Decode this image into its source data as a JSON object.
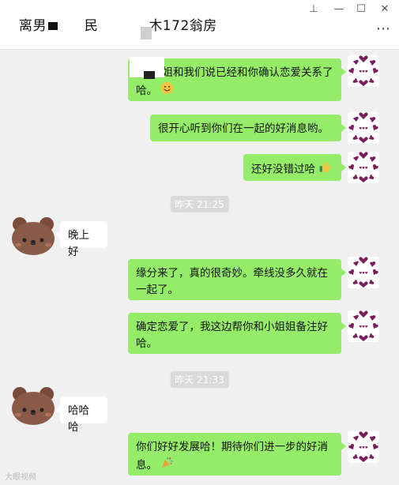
{
  "window": {
    "title_parts": [
      "离男",
      "民",
      "木172翁房"
    ],
    "pin_glyph": "⊥",
    "min_glyph": "—",
    "max_glyph": "☐",
    "close_glyph": "✕",
    "more_glyph": "⋯"
  },
  "messages": [
    {
      "side": "me",
      "text": "姐姐和我们说已经和你确认恋爱关系了哈。",
      "emoji": "smile-emoji"
    },
    {
      "side": "me",
      "text": "很开心听到你们在一起的好消息哟。"
    },
    {
      "side": "me",
      "text": "还好没错过哈",
      "emoji": "thumbs-up-emoji"
    },
    {
      "type": "time",
      "text": "昨天 21:25"
    },
    {
      "side": "other",
      "text": "晚上好"
    },
    {
      "side": "me",
      "text": "缘分来了，真的很奇妙。牵线没多久就在一起了。"
    },
    {
      "side": "me",
      "text": "确定恋爱了，我这边帮你和小姐姐备注好哈。"
    },
    {
      "type": "time",
      "text": "昨天 21:33"
    },
    {
      "side": "other",
      "text": "哈哈哈"
    },
    {
      "side": "me",
      "text": "你们好好发展哈！期待你们进一步的好消息。",
      "emoji": "party-emoji"
    }
  ],
  "watermark": "大眼视频",
  "colors": {
    "me_bubble": "#95ec69",
    "other_bubble": "#ffffff",
    "bg": "#f0f0f0",
    "heart": "#7a1f5c",
    "bear": "#7a4a3a"
  }
}
